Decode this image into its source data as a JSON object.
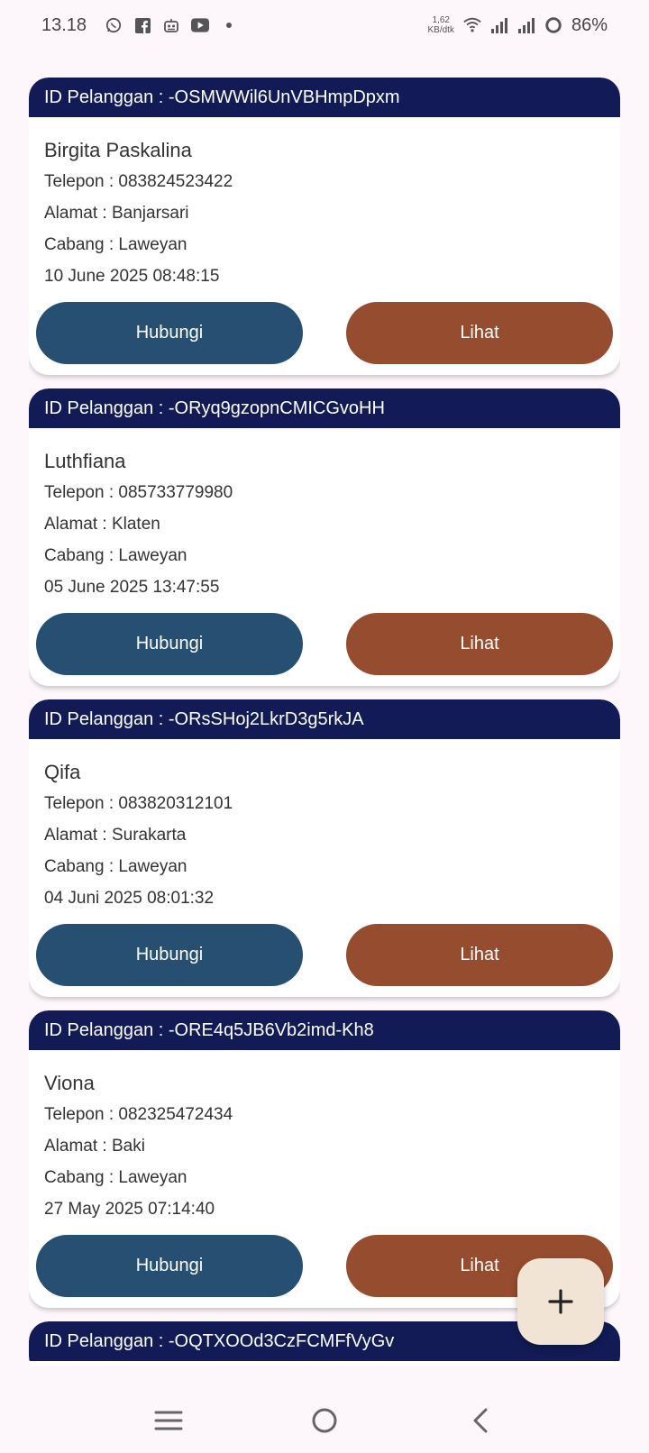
{
  "status_bar": {
    "time": "13.18",
    "speed_value": "1,62",
    "speed_unit": "KB/dtk",
    "battery": "86%",
    "icons": [
      "whatsapp-icon",
      "facebook-icon",
      "robot-icon",
      "youtube-icon",
      "dot-icon",
      "wifi-icon",
      "signal-icon",
      "signal-icon",
      "battery-ring-icon"
    ]
  },
  "customers": [
    {
      "id": "ID Pelanggan : -OSMWWil6UnVBHmpDpxm",
      "name": "Birgita Paskalina",
      "phone": "Telepon : 083824523422",
      "address": "Alamat : Banjarsari",
      "branch": "Cabang : Laweyan",
      "date": "10 June 2025 08:48:15",
      "call_label": "Hubungi",
      "view_label": "Lihat"
    },
    {
      "id": "ID Pelanggan : -ORyq9gzopnCMICGvoHH",
      "name": "Luthfiana",
      "phone": "Telepon : 085733779980",
      "address": "Alamat : Klaten",
      "branch": "Cabang : Laweyan",
      "date": "05 June 2025 13:47:55",
      "call_label": "Hubungi",
      "view_label": "Lihat"
    },
    {
      "id": "ID Pelanggan : -ORsSHoj2LkrD3g5rkJA",
      "name": "Qifa",
      "phone": "Telepon : 083820312101",
      "address": "Alamat : Surakarta",
      "branch": "Cabang : Laweyan",
      "date": "04 Juni 2025 08:01:32",
      "call_label": "Hubungi",
      "view_label": "Lihat"
    },
    {
      "id": "ID Pelanggan : -ORE4q5JB6Vb2imd-Kh8",
      "name": "Viona",
      "phone": "Telepon : 082325472434",
      "address": "Alamat : Baki",
      "branch": "Cabang : Laweyan",
      "date": "27 May 2025 07:14:40",
      "call_label": "Hubungi",
      "view_label": "Lihat"
    }
  ],
  "partial_card": {
    "id": "ID Pelanggan : -OQTXOOd3CzFCMFfVyGv"
  },
  "fab": {
    "icon": "plus-icon",
    "label": "+"
  },
  "colors": {
    "header": "#121b55",
    "call_button": "#264f72",
    "view_button": "#964c2e",
    "fab": "#f2e4d5",
    "background": "#fdf6fb"
  },
  "nav_bar": {
    "icons": [
      "menu-icon",
      "home-icon",
      "back-icon"
    ]
  }
}
